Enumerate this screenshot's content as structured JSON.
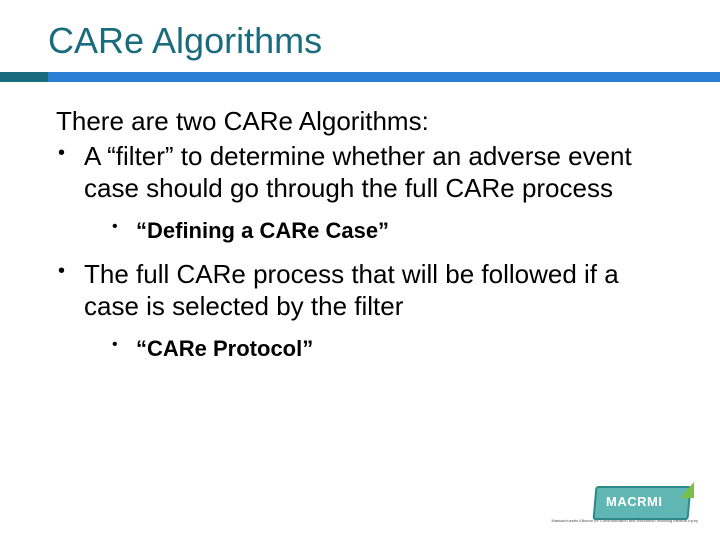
{
  "title": "CARe Algorithms",
  "intro": "There are two CARe Algorithms:",
  "items": [
    {
      "text": "A “filter” to determine whether an adverse event case should go through the full CARe process",
      "sub": [
        {
          "text": "“Defining a CARe Case”",
          "bold": true
        }
      ]
    },
    {
      "text": "The full CARe process that will be followed if a case is selected by the filter",
      "sub": [
        {
          "text": "“CARe Protocol”",
          "bold": true
        }
      ]
    }
  ],
  "logo": {
    "text": "MACRMI",
    "sub": "Massachusetts Alliance for Communication and Resolution following Medical Injury"
  }
}
